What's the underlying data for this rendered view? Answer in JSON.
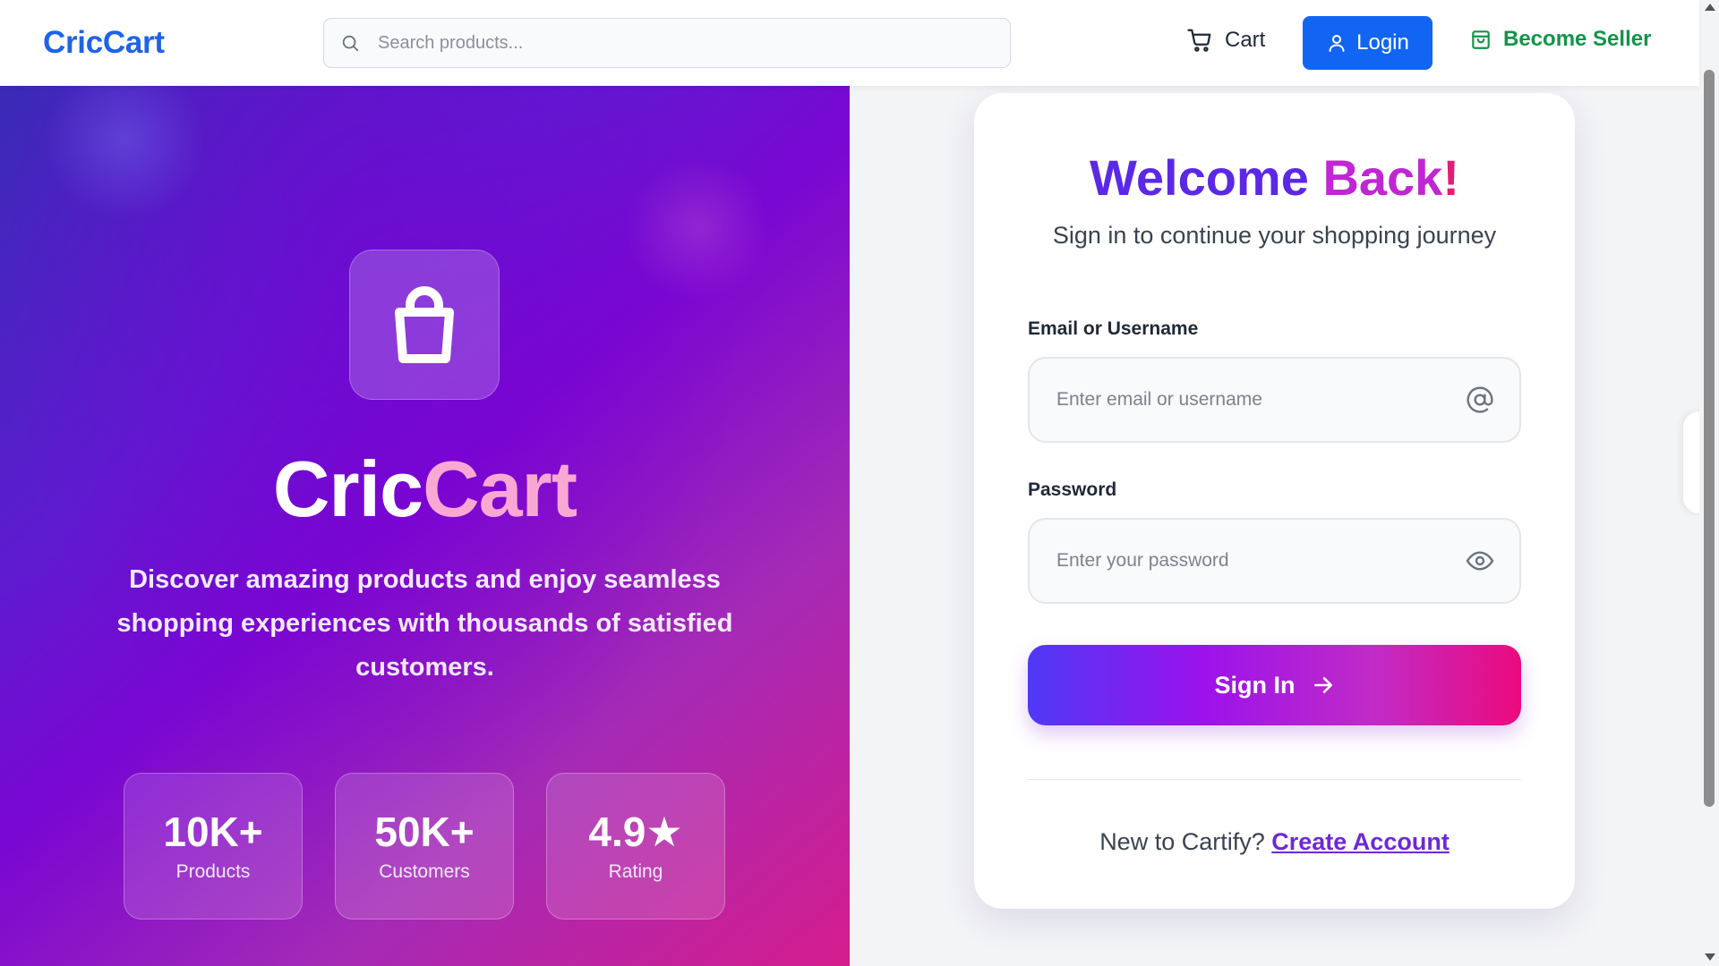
{
  "header": {
    "brand": "CricCart",
    "search_placeholder": "Search products...",
    "cart_label": "Cart",
    "login_label": "Login",
    "seller_label": "Become Seller"
  },
  "hero": {
    "title_part1": "Cric",
    "title_part2": "Cart",
    "description": "Discover amazing products and enjoy seamless shopping experiences with thousands of satisfied customers.",
    "stats": [
      {
        "value": "10K+",
        "label": "Products"
      },
      {
        "value": "50K+",
        "label": "Customers"
      },
      {
        "value": "4.9★",
        "label": "Rating"
      }
    ]
  },
  "login_card": {
    "title_word1": "Welcome",
    "title_word2": "Back",
    "title_mark": "!",
    "subtitle": "Sign in to continue your shopping journey",
    "email_label": "Email or Username",
    "email_placeholder": "Enter email or username",
    "password_label": "Password",
    "password_placeholder": "Enter your password",
    "signin_label": "Sign In",
    "footer_prefix": "New to Cartify?",
    "footer_link": "Create Account"
  },
  "colors": {
    "brand_blue": "#1e63e9",
    "login_button": "#1265f2",
    "seller_green": "#139448",
    "accent_purple": "#5b28e6",
    "accent_pink": "#ec0a7d"
  },
  "icons": {
    "search": "search-icon",
    "cart": "cart-icon",
    "user": "user-icon",
    "seller": "shopping-bag-icon",
    "logo": "shopping-bag-icon",
    "email": "at-sign-icon",
    "password": "eye-icon",
    "signin": "arrow-right-icon"
  }
}
